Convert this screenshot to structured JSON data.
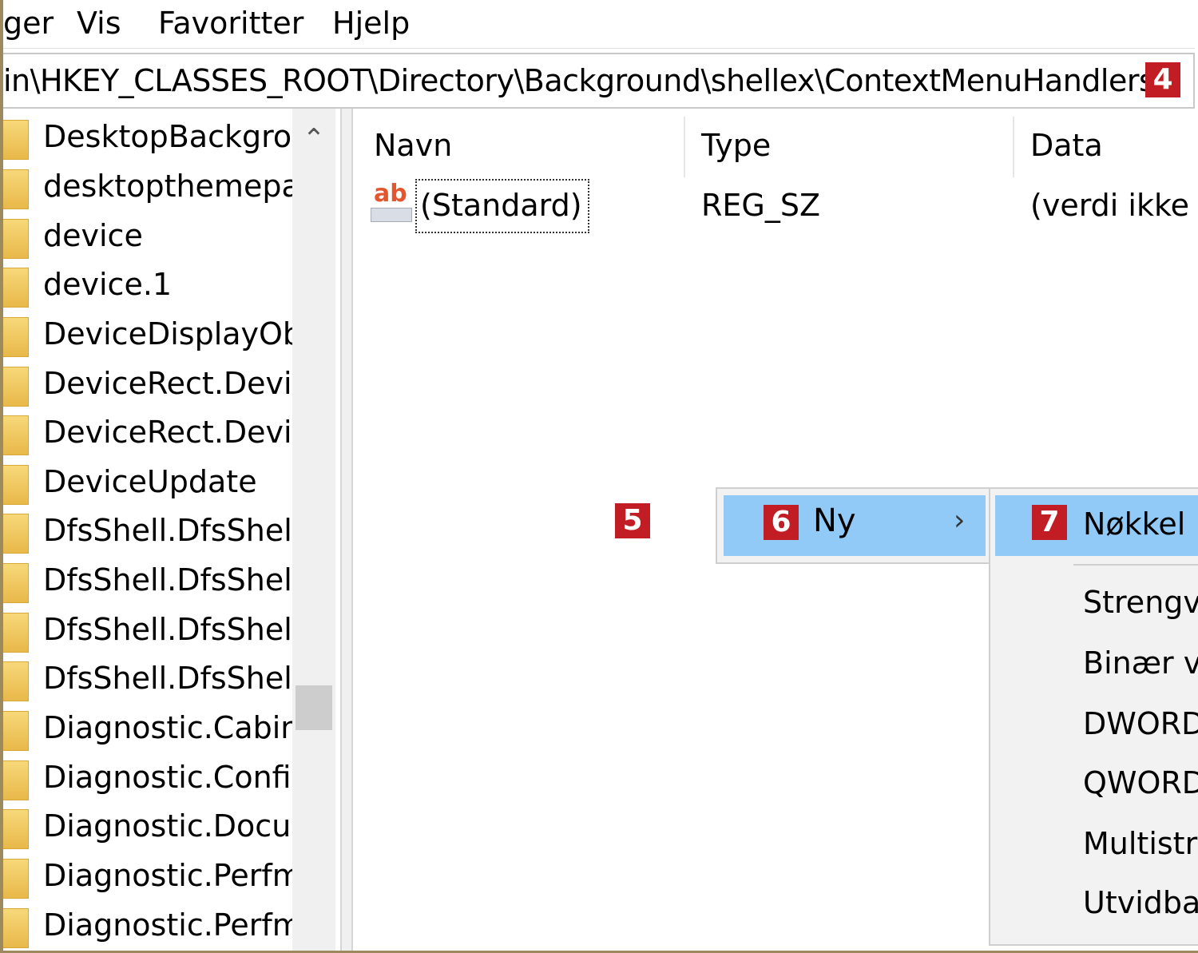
{
  "menubar": {
    "items": [
      "ger",
      "Vis",
      "Favoritter",
      "Hjelp"
    ]
  },
  "address": {
    "path": "in\\HKEY_CLASSES_ROOT\\Directory\\Background\\shellex\\ContextMenuHandlers",
    "badge": "4"
  },
  "tree": {
    "items": [
      "DesktopBackgrou",
      "desktopthemepa",
      "device",
      "device.1",
      "DeviceDisplayOb",
      "DeviceRect.Devic",
      "DeviceRect.Devic",
      "DeviceUpdate",
      "DfsShell.DfsShell",
      "DfsShell.DfsShell.",
      "DfsShell.DfsShellA",
      "DfsShell.DfsShellA",
      "Diagnostic.Cabin",
      "Diagnostic.Confi",
      "Diagnostic.Docur",
      "Diagnostic.Perfm",
      "Diagnostic.Perfm"
    ],
    "icon": "folder-icon"
  },
  "list": {
    "columns": [
      "Navn",
      "Type",
      "Data"
    ],
    "rows": [
      {
        "name": "(Standard)",
        "type": "REG_SZ",
        "data": "(verdi ikke a"
      }
    ],
    "value_icon": "string-value-icon"
  },
  "annotations": {
    "step5": "5",
    "step6": "6",
    "step7": "7"
  },
  "context_menu": {
    "item": "Ny",
    "arrow": "›"
  },
  "submenu": {
    "highlighted": "Nøkkel",
    "items": [
      "Strengv",
      "Binær v",
      "DWORD",
      "QWORD",
      "Multistr",
      "Utvidba"
    ]
  },
  "colors": {
    "menu_highlight": "#91c9f7",
    "badge": "#c21c24",
    "folder": "#f0c860"
  }
}
